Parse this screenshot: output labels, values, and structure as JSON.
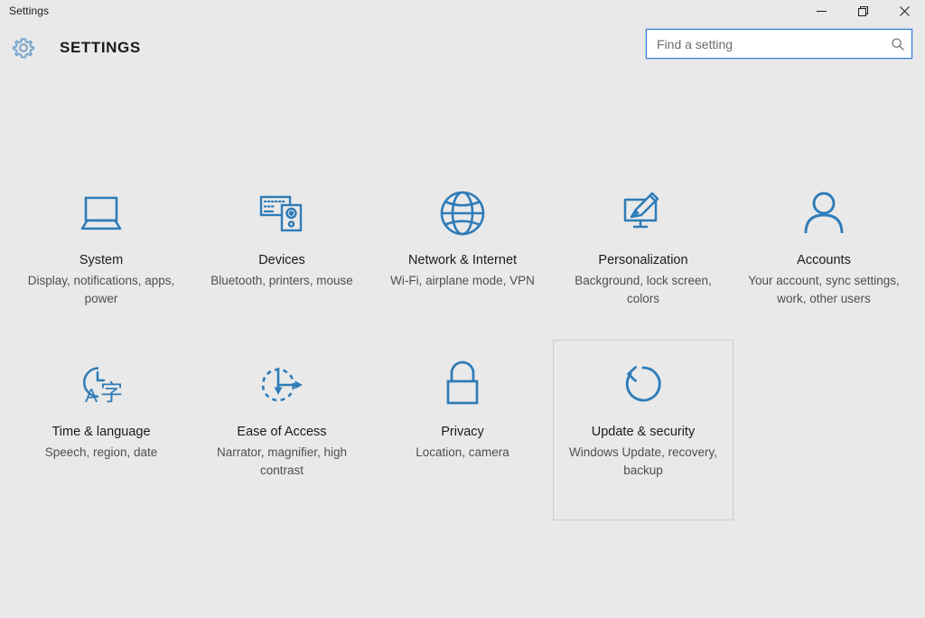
{
  "window": {
    "title": "Settings",
    "controls": [
      {
        "name": "minimize",
        "label": "Minimize"
      },
      {
        "name": "maximize",
        "label": "Restore"
      },
      {
        "name": "close",
        "label": "Close"
      }
    ]
  },
  "header": {
    "gear_icon": "gear-icon",
    "app_title": "SETTINGS"
  },
  "search": {
    "placeholder": "Find a setting",
    "value": "",
    "icon": "search-icon",
    "border_color": "#2b7cd3"
  },
  "theme": {
    "background": "#e9e9e9",
    "icon_blue": "#2e7cb8",
    "text_primary": "#1b1b1b",
    "text_secondary": "#4f4f4f",
    "focus_border": "#cdcdcd"
  },
  "tiles": [
    {
      "id": "system",
      "icon": "laptop-icon",
      "title": "System",
      "description": "Display, notifications, apps, power",
      "focused": false
    },
    {
      "id": "devices",
      "icon": "keyboard-device-icon",
      "title": "Devices",
      "description": "Bluetooth, printers, mouse",
      "focused": false
    },
    {
      "id": "network-internet",
      "icon": "globe-icon",
      "title": "Network & Internet",
      "description": "Wi-Fi, airplane mode, VPN",
      "focused": false
    },
    {
      "id": "personalization",
      "icon": "monitor-brush-icon",
      "title": "Personalization",
      "description": "Background, lock screen, colors",
      "focused": false
    },
    {
      "id": "accounts",
      "icon": "person-icon",
      "title": "Accounts",
      "description": "Your account, sync settings, work, other users",
      "focused": false
    },
    {
      "id": "time-language",
      "icon": "clock-language-icon",
      "title": "Time & language",
      "description": "Speech, region, date",
      "focused": false
    },
    {
      "id": "ease-of-access",
      "icon": "accessibility-arrows-icon",
      "title": "Ease of Access",
      "description": "Narrator, magnifier, high contrast",
      "focused": false
    },
    {
      "id": "privacy",
      "icon": "padlock-icon",
      "title": "Privacy",
      "description": "Location, camera",
      "focused": false
    },
    {
      "id": "update-security",
      "icon": "refresh-circle-icon",
      "title": "Update & security",
      "description": "Windows Update, recovery, backup",
      "focused": true
    }
  ]
}
